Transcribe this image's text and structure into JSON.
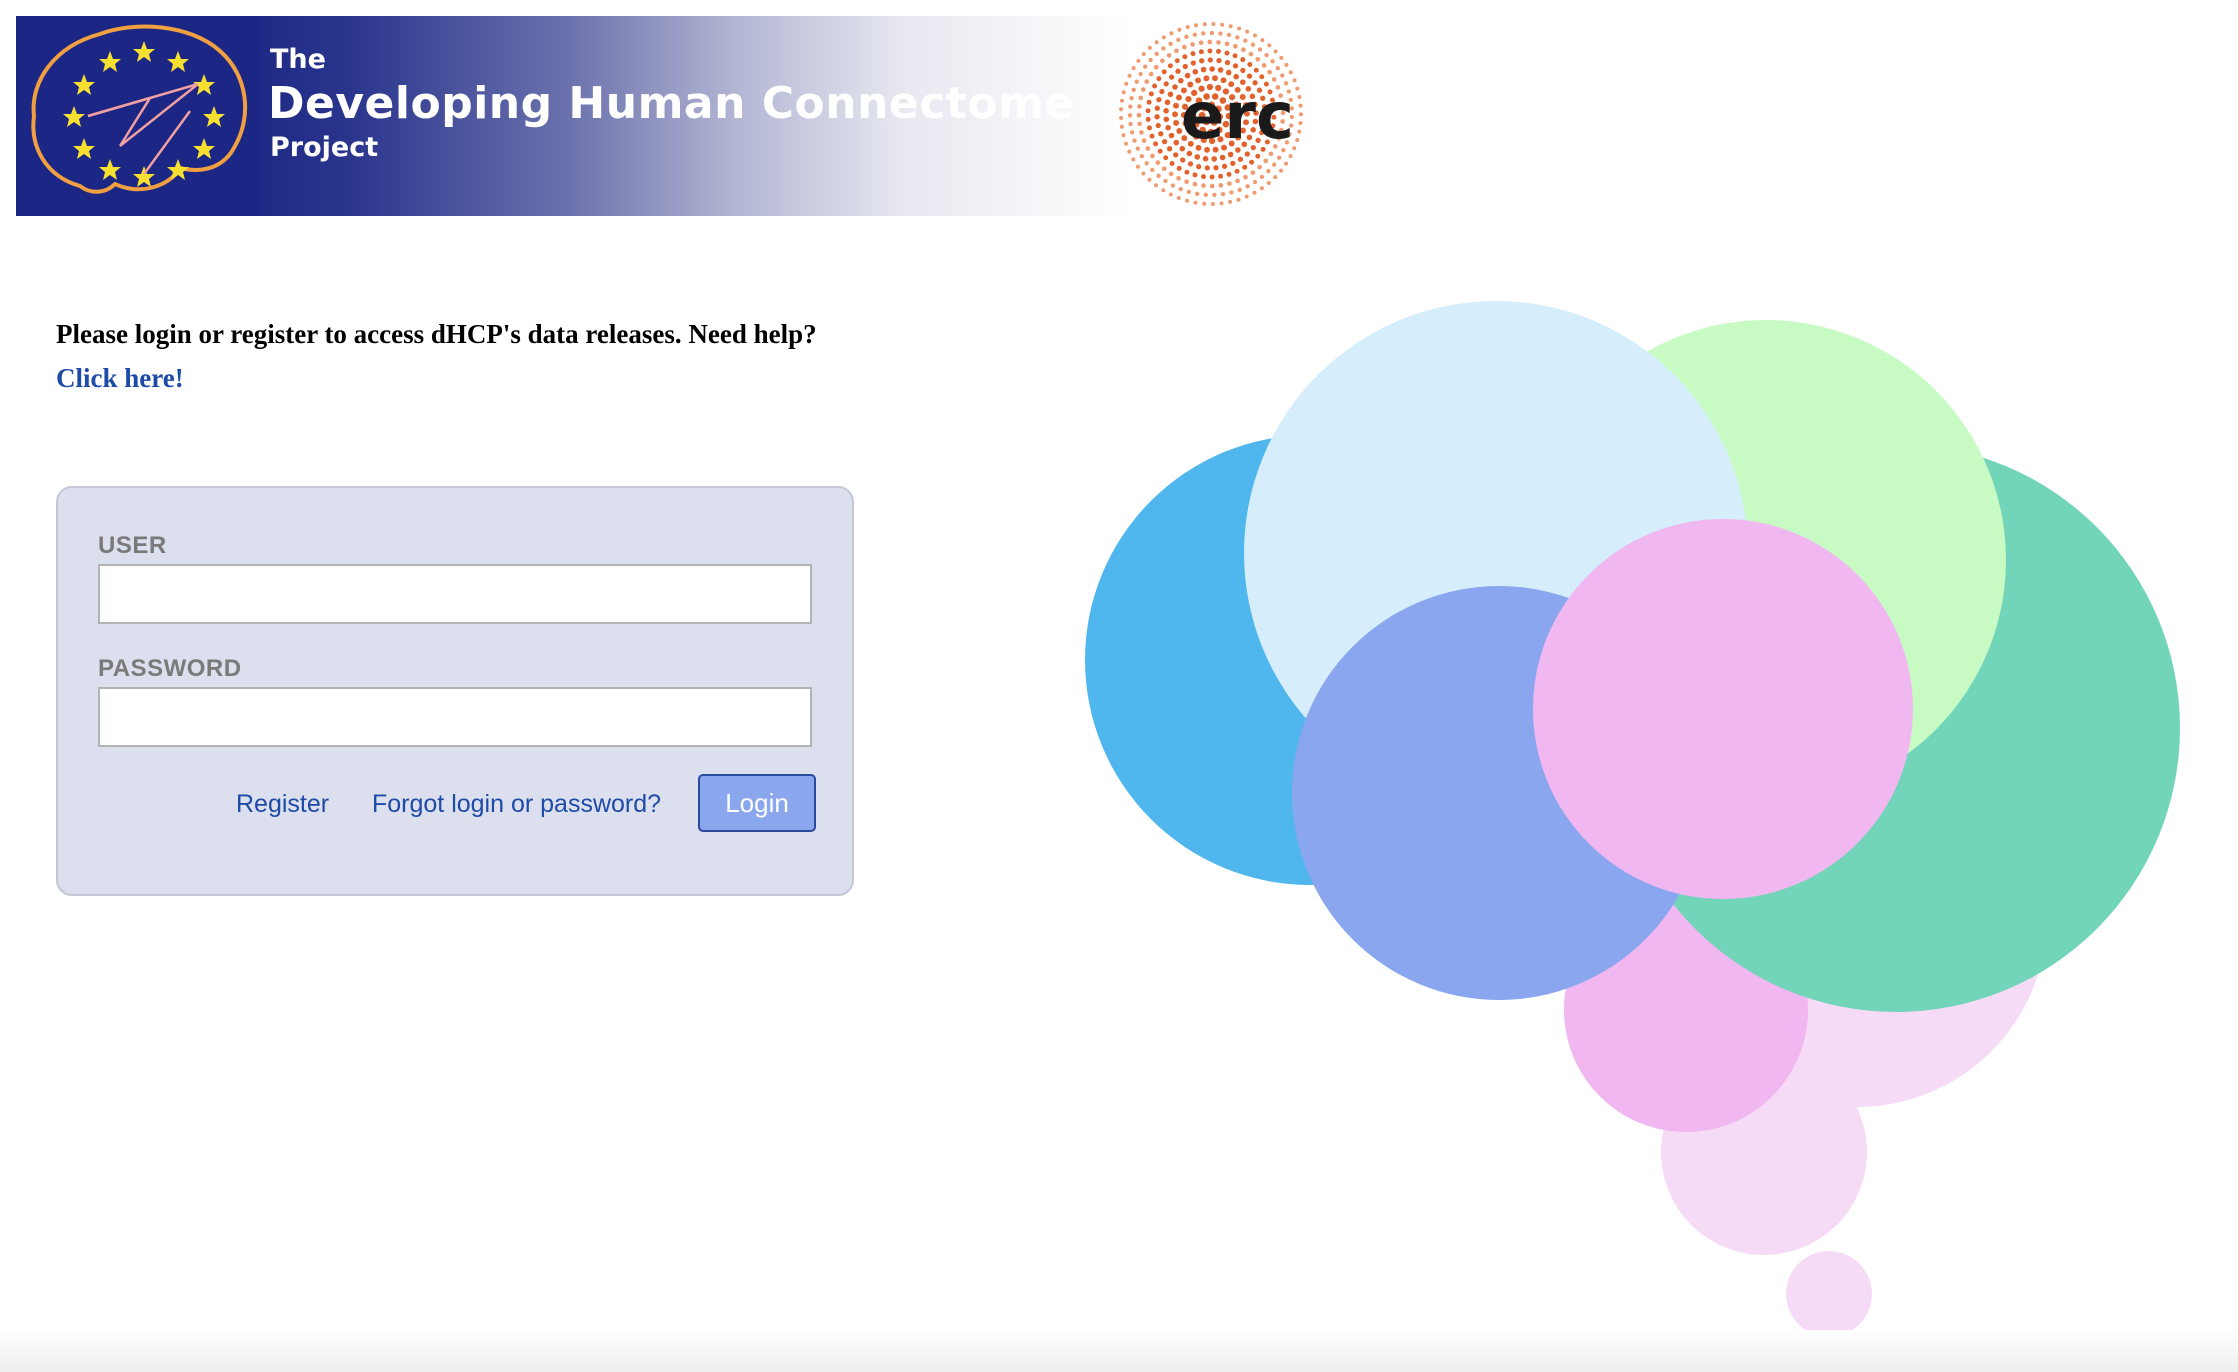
{
  "header": {
    "logo_icon": "dhcp-brain-stars-logo",
    "banner_the": "The",
    "banner_title": "Developing Human Connectome",
    "banner_project": "Project",
    "partner_logo": "erc-logo",
    "partner_logo_text": "erc"
  },
  "intro": {
    "text": "Please login or register to access dHCP's data releases. Need help?",
    "help_link": "Click here!"
  },
  "login": {
    "user_label": "USER",
    "user_value": "",
    "password_label": "PASSWORD",
    "password_value": "",
    "register_link": "Register",
    "forgot_link": "Forgot login or password?",
    "login_button": "Login"
  },
  "colors": {
    "banner_dark": "#1b2685",
    "link": "#1e4aa8",
    "panel_bg": "#dcdfee",
    "button_bg": "#8aa6ec",
    "bubble_blue": "#4fb6ee",
    "bubble_light_blue": "#d6edfb",
    "bubble_light_green": "#c8fbc4",
    "bubble_green": "#72d4b8",
    "bubble_periwinkle": "#8aa6ee",
    "bubble_pink": "#f1b7f0",
    "bubble_light_pink": "#f6dbf7"
  }
}
